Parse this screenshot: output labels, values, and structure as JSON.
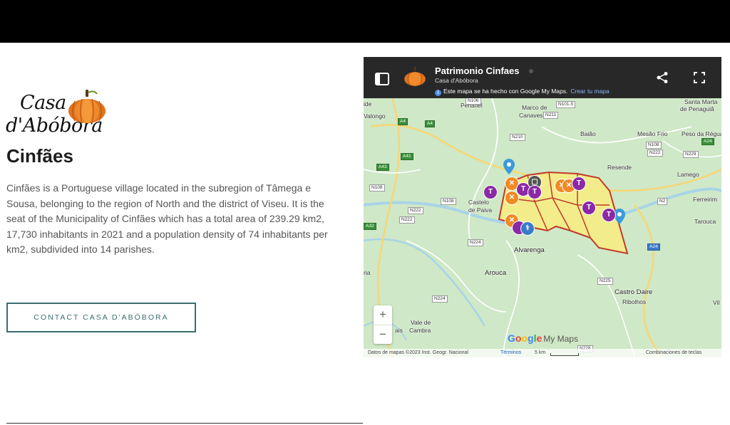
{
  "logo": {
    "line1": "Casa",
    "line2": "d'Abóbora",
    "icon": "pumpkin-icon"
  },
  "page": {
    "title": "Cinfães",
    "description": "Cinfães is a Portuguese village located in the subregion of Tâmega e Sousa, belonging to the region of North and the district of Viseu. It is the seat of the Municipality of Cinfães which has a total area of 239.29 km2, 17,730 inhabitants in 2021 and a population density of 74 inhabitants per km2, subdivided into 14 parishes.",
    "contact_button": "CONTACT CASA D'ABÓBORA"
  },
  "map": {
    "title": "Patrimonio Cinfaes",
    "subtitle": "Casa d'Abóbora",
    "info_text": "Este mapa se ha hecho con Google My Maps.",
    "info_link": "Crear tu mapa",
    "places": {
      "penafiel": "Penafiel",
      "valongo": "Valongo",
      "marco": "Marco de",
      "canaveses": "Canaveses",
      "baiao": "Baião",
      "mesao_frio": "Mesão Frio",
      "peso_regua": "Peso da Régua",
      "santa_marta": "Santa Marta",
      "penaguiao": "de Penaguiã",
      "resende": "Resende",
      "lamego": "Lamego",
      "ferreirim": "Ferreirim",
      "tarouca": "Tarouca",
      "castelo": "Castelo",
      "paiva": "de Paiva",
      "alvarenga": "Alvarenga",
      "arouca": "Arouca",
      "castro_daire": "Castro Daire",
      "ribolhos": "Ribolhos",
      "vale_de": "Vale de",
      "cambra": "Cambra",
      "ide": "ide",
      "ria": "ria",
      "ais": "ais",
      "vila": "Vil"
    },
    "roads": {
      "n106": "N106",
      "n1015": "N101-5",
      "n211": "N211",
      "n210": "N210",
      "a4": "A4",
      "n108": "N108",
      "n222": "N222",
      "a24": "A24",
      "a41": "A41",
      "a43": "A43",
      "n108b": "N108",
      "n222b": "N222",
      "a32": "A32",
      "n2": "N2",
      "n224": "N224",
      "a24b": "A24",
      "n225": "N225",
      "n224b": "N224",
      "n228": "N228",
      "n222c": "N222",
      "n229": "N229"
    },
    "pin_labels": {
      "t": "T"
    },
    "zoom_in": "+",
    "zoom_out": "−",
    "google": [
      "G",
      "o",
      "o",
      "g",
      "l",
      "e"
    ],
    "mymaps": "My Maps",
    "attribution": "Datos de mapas ©2023 Inst. Geogr. Nacional",
    "terms": "Términos",
    "scale": "5 km",
    "keyboard": "Combinaciones de teclas",
    "colors": {
      "header": "#282828",
      "land": "#cfe8c7",
      "region_fill": "#f2ed8a",
      "region_border": "#c0392b",
      "accent_pin": "#8b2aa6"
    }
  }
}
